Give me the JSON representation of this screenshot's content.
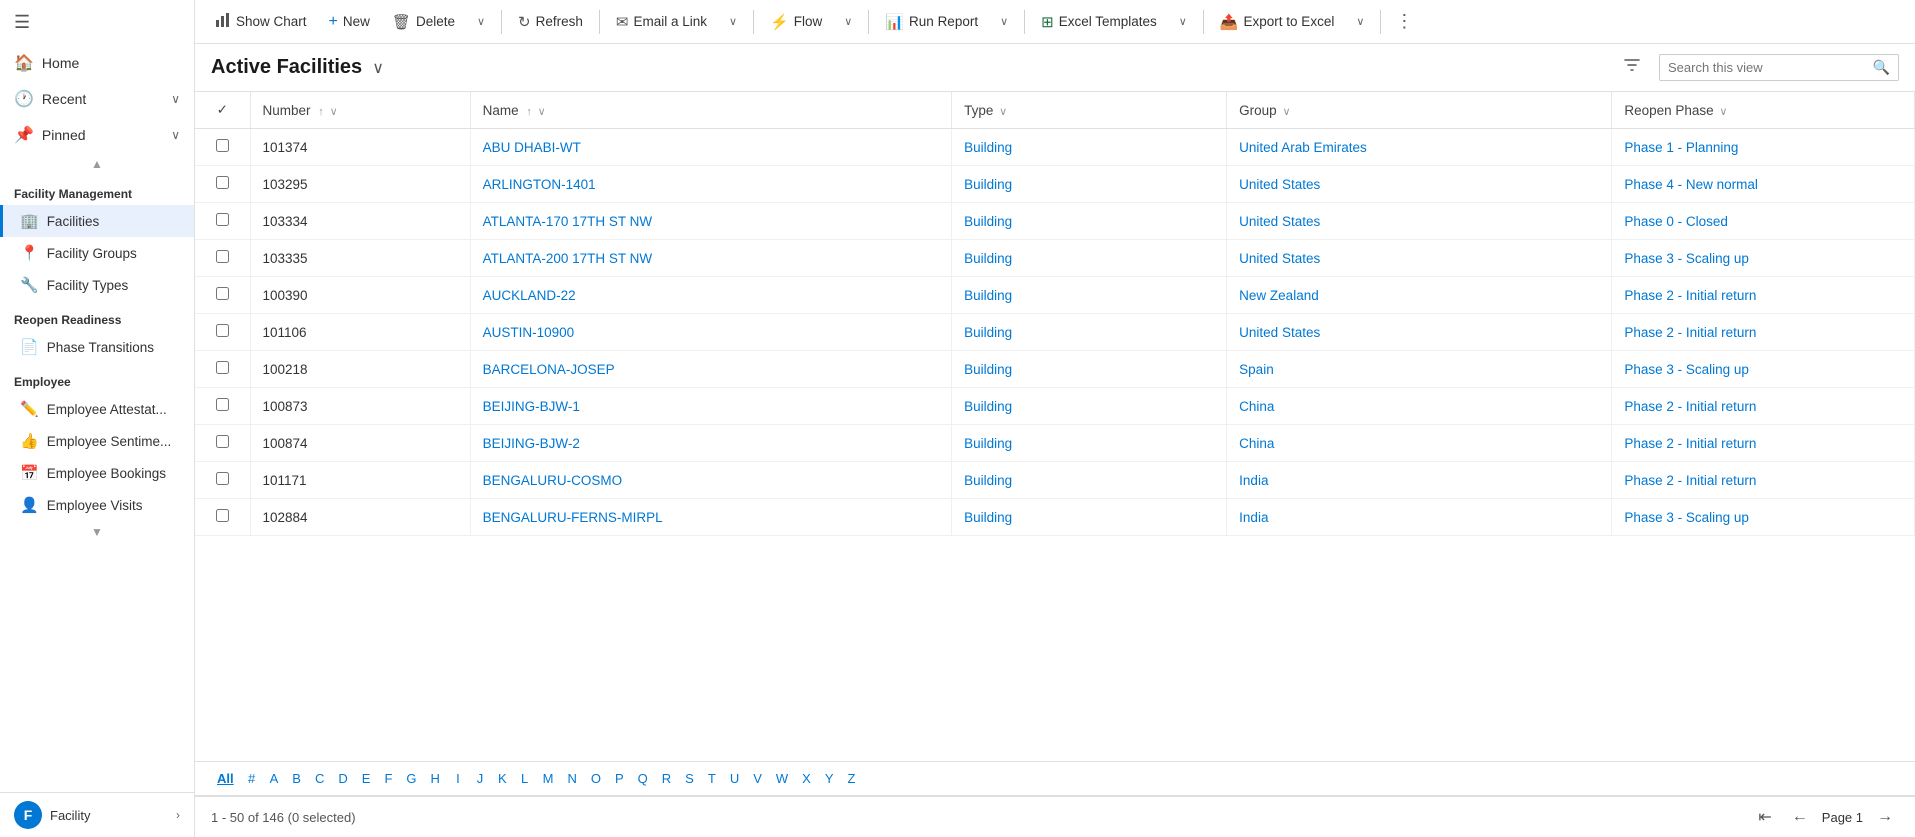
{
  "sidebar": {
    "hamburger_icon": "☰",
    "nav_items": [
      {
        "id": "home",
        "label": "Home",
        "icon": "🏠",
        "has_chevron": false
      },
      {
        "id": "recent",
        "label": "Recent",
        "icon": "🕐",
        "has_chevron": true
      },
      {
        "id": "pinned",
        "label": "Pinned",
        "icon": "📌",
        "has_chevron": true
      }
    ],
    "sections": [
      {
        "title": "Facility Management",
        "items": [
          {
            "id": "facilities",
            "label": "Facilities",
            "icon": "🏢",
            "active": true
          },
          {
            "id": "facility-groups",
            "label": "Facility Groups",
            "icon": "📍",
            "active": false
          },
          {
            "id": "facility-types",
            "label": "Facility Types",
            "icon": "🔧",
            "active": false
          }
        ]
      },
      {
        "title": "Reopen Readiness",
        "items": [
          {
            "id": "phase-transitions",
            "label": "Phase Transitions",
            "icon": "📄",
            "active": false
          }
        ]
      },
      {
        "title": "Employee",
        "items": [
          {
            "id": "employee-attestat",
            "label": "Employee Attestat...",
            "icon": "✏️",
            "active": false
          },
          {
            "id": "employee-sentime",
            "label": "Employee Sentime...",
            "icon": "👍",
            "active": false
          },
          {
            "id": "employee-bookings",
            "label": "Employee Bookings",
            "icon": "📅",
            "active": false
          },
          {
            "id": "employee-visits",
            "label": "Employee Visits",
            "icon": "👤",
            "active": false
          }
        ]
      }
    ],
    "bottom": {
      "avatar_letter": "F",
      "label": "Facility"
    }
  },
  "toolbar": {
    "show_chart_label": "Show Chart",
    "new_label": "New",
    "delete_label": "Delete",
    "refresh_label": "Refresh",
    "email_link_label": "Email a Link",
    "flow_label": "Flow",
    "run_report_label": "Run Report",
    "excel_templates_label": "Excel Templates",
    "export_excel_label": "Export to Excel"
  },
  "view": {
    "title": "Active Facilities",
    "search_placeholder": "Search this view",
    "filter_icon": "⊞"
  },
  "table": {
    "columns": [
      {
        "id": "check",
        "label": "✓",
        "sortable": false
      },
      {
        "id": "number",
        "label": "Number",
        "sort": "asc",
        "has_chevron": true
      },
      {
        "id": "name",
        "label": "Name",
        "sort": "asc",
        "has_chevron": true
      },
      {
        "id": "type",
        "label": "Type",
        "has_chevron": true
      },
      {
        "id": "group",
        "label": "Group",
        "has_chevron": true
      },
      {
        "id": "reopen_phase",
        "label": "Reopen Phase",
        "has_chevron": true
      }
    ],
    "rows": [
      {
        "number": "101374",
        "name": "ABU DHABI-WT",
        "type": "Building",
        "group": "United Arab Emirates",
        "reopen_phase": "Phase 1 - Planning"
      },
      {
        "number": "103295",
        "name": "ARLINGTON-1401",
        "type": "Building",
        "group": "United States",
        "reopen_phase": "Phase 4 - New normal"
      },
      {
        "number": "103334",
        "name": "ATLANTA-170 17TH ST NW",
        "type": "Building",
        "group": "United States",
        "reopen_phase": "Phase 0 - Closed"
      },
      {
        "number": "103335",
        "name": "ATLANTA-200 17TH ST NW",
        "type": "Building",
        "group": "United States",
        "reopen_phase": "Phase 3 - Scaling up"
      },
      {
        "number": "100390",
        "name": "AUCKLAND-22",
        "type": "Building",
        "group": "New Zealand",
        "reopen_phase": "Phase 2 - Initial return"
      },
      {
        "number": "101106",
        "name": "AUSTIN-10900",
        "type": "Building",
        "group": "United States",
        "reopen_phase": "Phase 2 - Initial return"
      },
      {
        "number": "100218",
        "name": "BARCELONA-JOSEP",
        "type": "Building",
        "group": "Spain",
        "reopen_phase": "Phase 3 - Scaling up"
      },
      {
        "number": "100873",
        "name": "BEIJING-BJW-1",
        "type": "Building",
        "group": "China",
        "reopen_phase": "Phase 2 - Initial return"
      },
      {
        "number": "100874",
        "name": "BEIJING-BJW-2",
        "type": "Building",
        "group": "China",
        "reopen_phase": "Phase 2 - Initial return"
      },
      {
        "number": "101171",
        "name": "BENGALURU-COSMO",
        "type": "Building",
        "group": "India",
        "reopen_phase": "Phase 2 - Initial return"
      },
      {
        "number": "102884",
        "name": "BENGALURU-FERNS-MIRPL",
        "type": "Building",
        "group": "India",
        "reopen_phase": "Phase 3 - Scaling up"
      }
    ]
  },
  "alpha_bar": {
    "items": [
      "All",
      "#",
      "A",
      "B",
      "C",
      "D",
      "E",
      "F",
      "G",
      "H",
      "I",
      "J",
      "K",
      "L",
      "M",
      "N",
      "O",
      "P",
      "Q",
      "R",
      "S",
      "T",
      "U",
      "V",
      "W",
      "X",
      "Y",
      "Z"
    ],
    "active": "All"
  },
  "footer": {
    "range_text": "1 - 50 of 146 (0 selected)",
    "page_label": "Page 1"
  }
}
